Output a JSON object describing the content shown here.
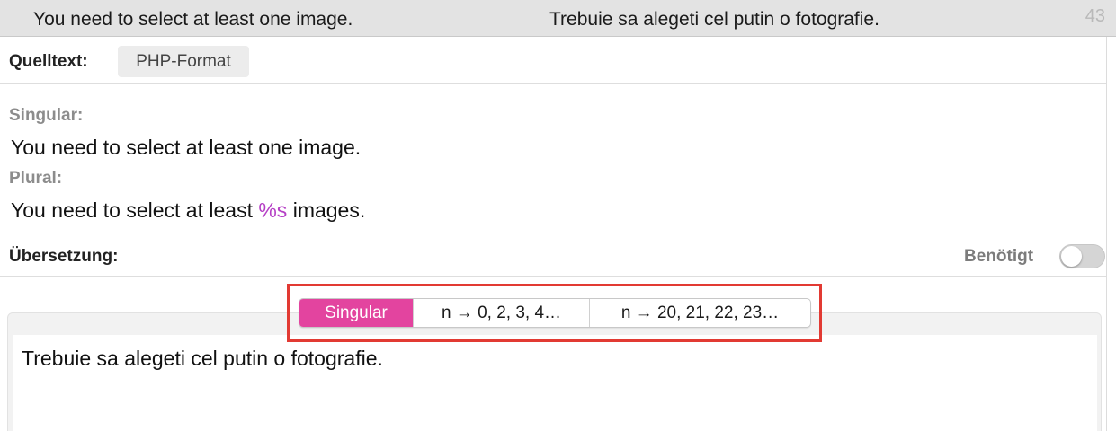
{
  "top_row": {
    "source": "You need to select at least one image.",
    "translation": "Trebuie sa alegeti cel putin o fotografie.",
    "number": "43"
  },
  "source_header": {
    "label": "Quelltext:",
    "format_badge": "PHP-Format"
  },
  "source": {
    "singular_label": "Singular:",
    "singular_text": "You need to select at least one image.",
    "plural_label": "Plural:",
    "plural_text_before": "You need to select at least ",
    "plural_placeholder": "%s",
    "plural_text_after": " images."
  },
  "translation_header": {
    "label": "Übersetzung:",
    "required_label": "Benötigt",
    "required_on": false
  },
  "plural_tabs": [
    {
      "label": "Singular",
      "active": true
    },
    {
      "label": "n → 0, 2, 3, 4…",
      "active": false
    },
    {
      "label": "n → 20, 21, 22, 23…",
      "active": false
    }
  ],
  "editor": {
    "text": "Trebuie sa alegeti cel putin o fotografie."
  },
  "colors": {
    "accent_active_tab": "#e3449f",
    "placeholder": "#b53fc5",
    "highlight_border": "#e23a33"
  }
}
